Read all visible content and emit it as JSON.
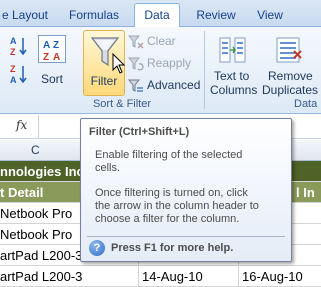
{
  "ribbon_tabs": [
    "e Layout",
    "Formulas",
    "Data",
    "Review",
    "View"
  ],
  "active_tab": "Data",
  "buttons": {
    "sort": "Sort",
    "filter": "Filter",
    "clear": "Clear",
    "reapply": "Reapply",
    "advanced": "Advanced",
    "text_to_columns_1": "Text to",
    "text_to_columns_2": "Columns",
    "remove_duplicates_1": "Remove",
    "remove_duplicates_2": "Duplicates"
  },
  "group_labels": {
    "sort_filter": "Sort & Filter",
    "data_tools": "Data"
  },
  "formula_bar": {
    "fx_label": "fx"
  },
  "column_header": "C",
  "grid": {
    "band_title": "nnologies Inc.",
    "header_left": "t Detail",
    "header_right": "l In",
    "rows": [
      {
        "c": "Netbook Pro",
        "d": "",
        "e": ""
      },
      {
        "c": "Netbook Pro",
        "d": "",
        "e": ""
      },
      {
        "c": "artPad L200-3",
        "d": "",
        "e": ""
      },
      {
        "c": "artPad L200-3",
        "d": "14-Aug-10",
        "e": "16-Aug-10"
      }
    ]
  },
  "tooltip": {
    "title": "Filter (Ctrl+Shift+L)",
    "line1": "Enable filtering of the selected",
    "line2": "cells.",
    "line3": "Once filtering is turned on, click",
    "line4": "the arrow in the column header to",
    "line5": "choose a filter for the column.",
    "help": "Press F1 for more help."
  },
  "colors": {
    "band_dark": "#4f6228",
    "band_light": "#8a9a5b",
    "filter_highlight": "#ffd97a"
  }
}
